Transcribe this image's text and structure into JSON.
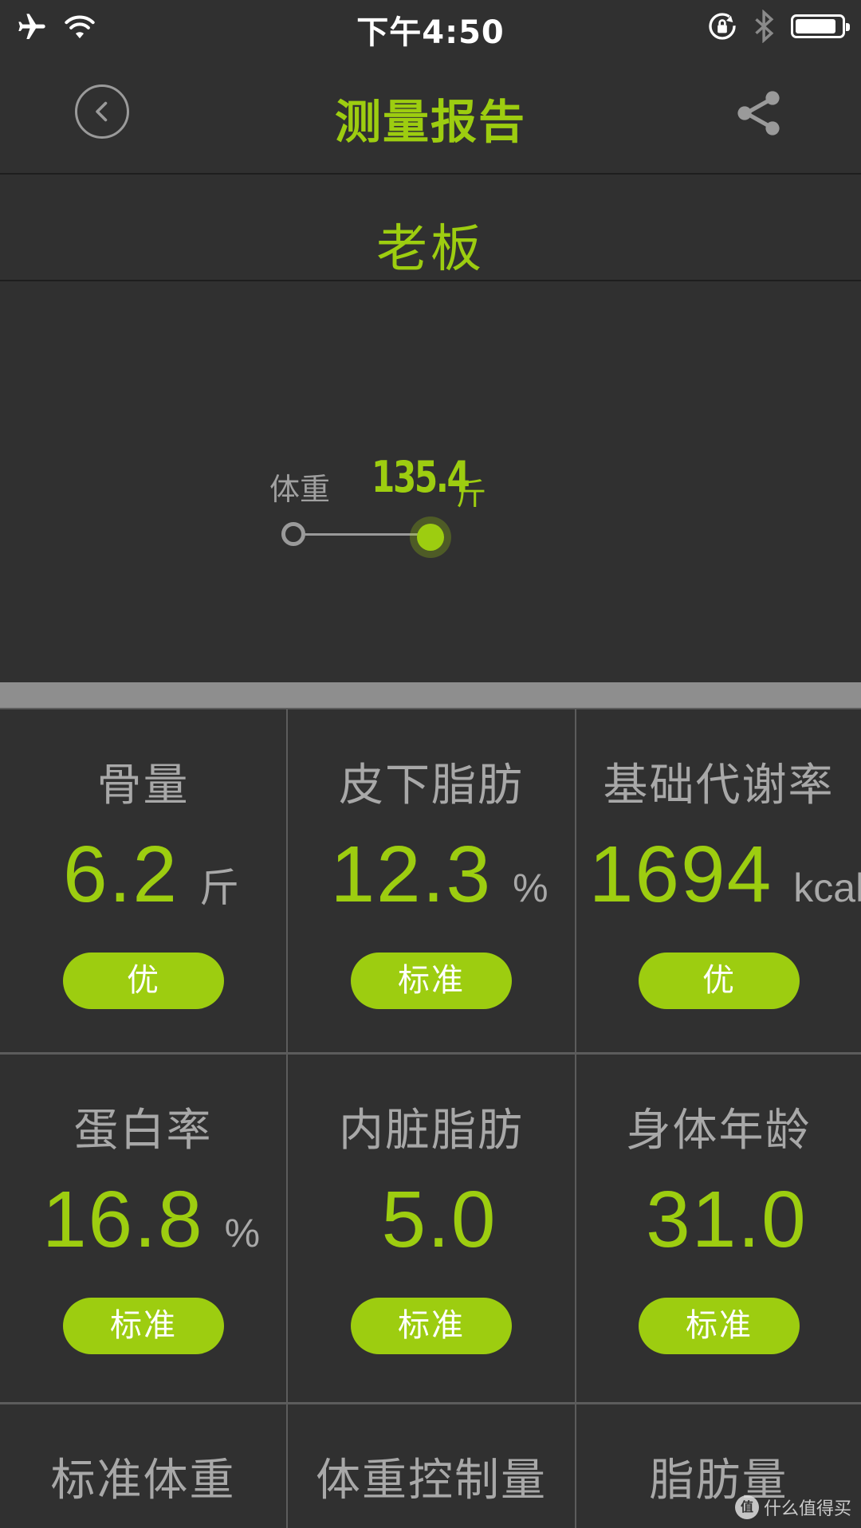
{
  "status_bar": {
    "time": "下午4:50",
    "icons": [
      "airplane-icon",
      "wifi-icon",
      "rotation-lock-icon",
      "bluetooth-icon",
      "battery-icon"
    ],
    "battery_level": 0.9
  },
  "nav": {
    "title": "测量报告",
    "back_icon": "back-circle-icon",
    "share_icon": "share-icon"
  },
  "profile": {
    "name": "老板"
  },
  "weight": {
    "label": "体重",
    "value": "135.4",
    "unit": "斤"
  },
  "metrics": [
    {
      "label": "骨量",
      "value": "6.2",
      "unit": "斤",
      "status": "优"
    },
    {
      "label": "皮下脂肪",
      "value": "12.3",
      "unit": "%",
      "status": "标准"
    },
    {
      "label": "基础代谢率",
      "value": "1694",
      "unit": "kcal",
      "status": "优"
    },
    {
      "label": "蛋白率",
      "value": "16.8",
      "unit": "%",
      "status": "标准"
    },
    {
      "label": "内脏脂肪",
      "value": "5.0",
      "unit": "",
      "status": "标准"
    },
    {
      "label": "身体年龄",
      "value": "31.0",
      "unit": "",
      "status": "标准"
    },
    {
      "label": "标准体重",
      "value": "",
      "unit": "",
      "status": ""
    },
    {
      "label": "体重控制量",
      "value": "",
      "unit": "",
      "status": ""
    },
    {
      "label": "脂肪量",
      "value": "",
      "unit": "",
      "status": ""
    }
  ],
  "watermark": {
    "logo": "值",
    "text": "什么值得买"
  },
  "colors": {
    "accent": "#9dcd10",
    "background": "#303030",
    "separator": "#8e8e8e",
    "muted_text": "#a8a8a8"
  }
}
